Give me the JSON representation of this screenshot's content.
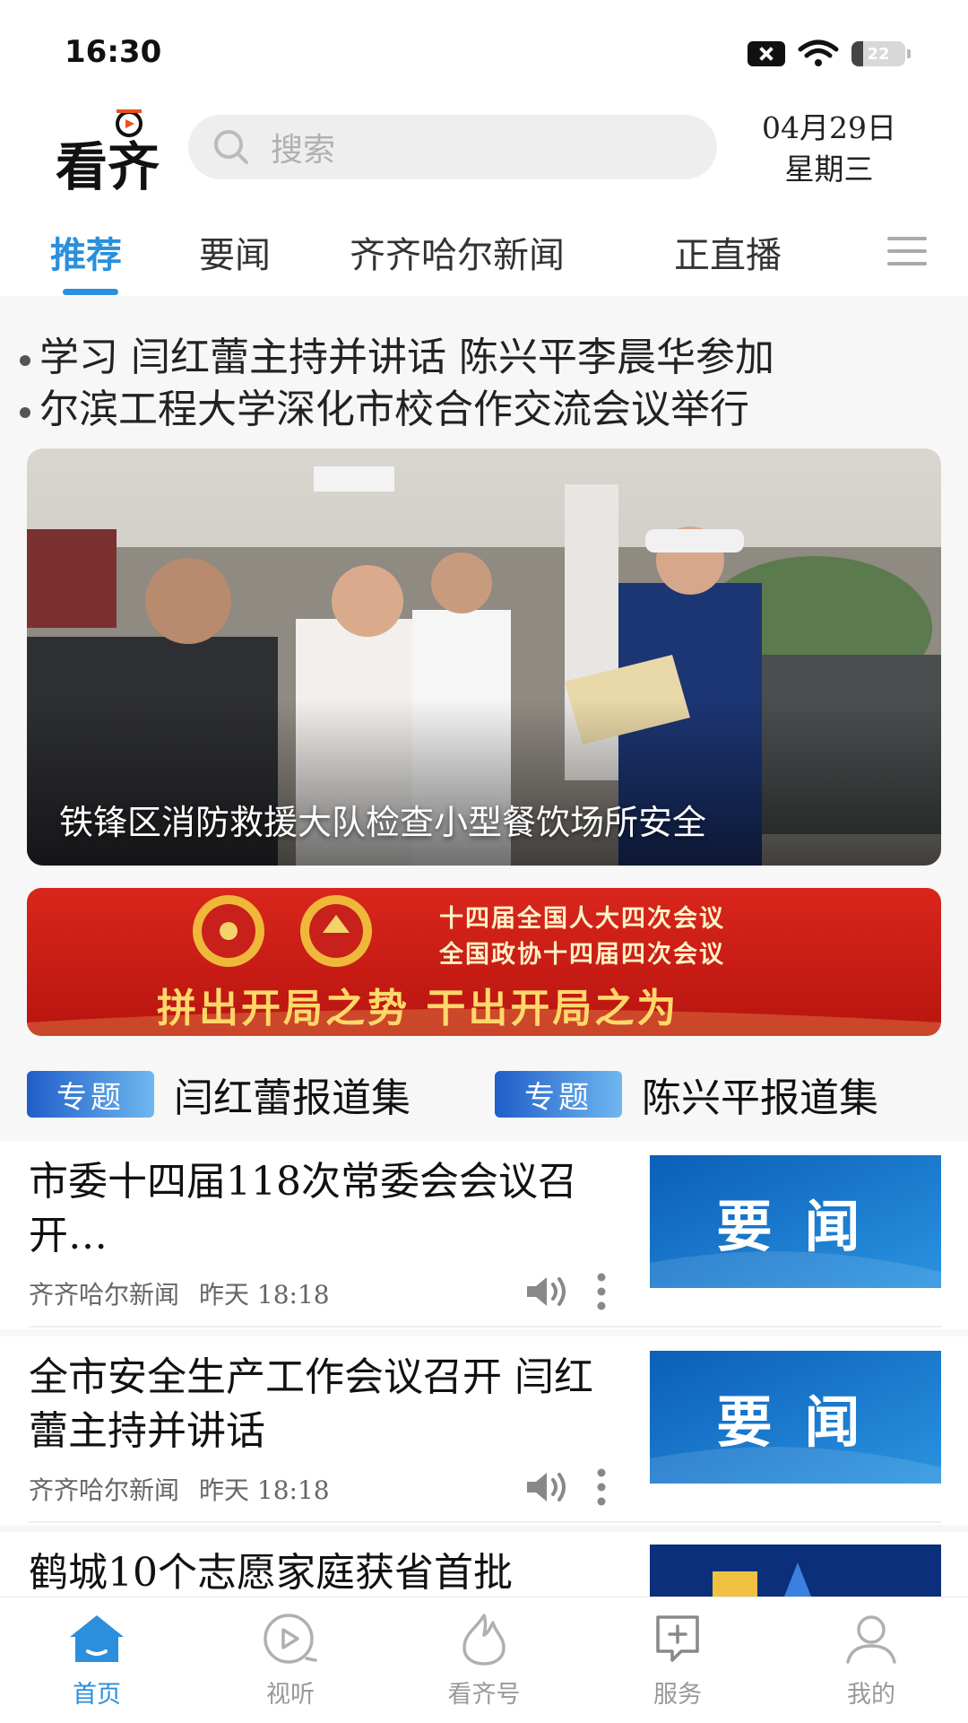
{
  "status_bar": {
    "time": "16:30",
    "battery": "22",
    "battery_level": 0.22
  },
  "header": {
    "logo_text": "看齐",
    "search_placeholder": "搜索",
    "date": "04月29日",
    "weekday": "星期三"
  },
  "tabs": [
    {
      "label": "推荐",
      "active": true
    },
    {
      "label": "要闻"
    },
    {
      "label": "齐齐哈尔新闻"
    },
    {
      "label": "正直播"
    }
  ],
  "ticker": [
    "学习 闫红蕾主持并讲话 陈兴平李晨华参加",
    "尔滨工程大学深化市校合作交流会议举行"
  ],
  "hero": {
    "caption": "铁锋区消防救援大队检查小型餐饮场所安全"
  },
  "banner": {
    "line1": "十四届全国人大四次会议",
    "line2": "全国政协十四届四次会议",
    "slogan": "拼出开局之势  干出开局之为"
  },
  "topics": [
    {
      "badge": "专题",
      "title": "闫红蕾报道集"
    },
    {
      "badge": "专题",
      "title": "陈兴平报道集"
    }
  ],
  "news": [
    {
      "title": "市委十四届118次常委会会议召开…",
      "source": "齐齐哈尔新闻",
      "time": "昨天 18:18",
      "thumb_text": "要闻"
    },
    {
      "title": "全市安全生产工作会议召开 闫红蕾主持并讲话",
      "source": "齐齐哈尔新闻",
      "time": "昨天 18:18",
      "thumb_text": "要闻"
    },
    {
      "title": "鹤城10个志愿家庭获省首批",
      "source": "",
      "time": "",
      "thumb_text": ""
    }
  ],
  "bottom_nav": [
    {
      "label": "首页",
      "icon": "home-icon",
      "active": true
    },
    {
      "label": "视听",
      "icon": "video-icon"
    },
    {
      "label": "看齐号",
      "icon": "flame-icon"
    },
    {
      "label": "服务",
      "icon": "service-icon"
    },
    {
      "label": "我的",
      "icon": "profile-icon"
    }
  ],
  "colors": {
    "accent": "#2a8fdc",
    "banner_red": "#d9261c",
    "topic_badge": "#1f5ec8"
  }
}
